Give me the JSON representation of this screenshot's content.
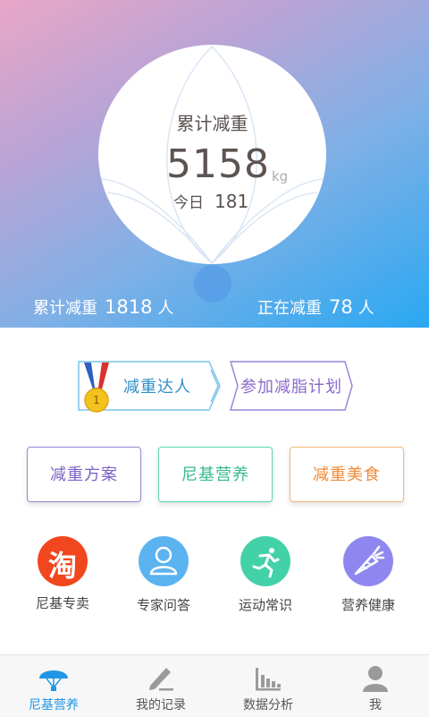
{
  "hero": {
    "title": "累计减重",
    "value": "5158",
    "unit": "kg",
    "today_label": "今日",
    "today_value": "181",
    "stats": {
      "left_label": "累计减重",
      "left_value": "1818",
      "left_unit": "人",
      "right_label": "正在减重",
      "right_value": "78",
      "right_unit": "人"
    }
  },
  "banners": {
    "expert": {
      "label": "减重达人",
      "badge": "1"
    },
    "join": {
      "label": "参加减脂计划"
    }
  },
  "plans": [
    {
      "label": "减重方案",
      "color": "#7a62c4"
    },
    {
      "label": "尼基营养",
      "color": "#36b890"
    },
    {
      "label": "减重美食",
      "color": "#f08a36"
    }
  ],
  "features": [
    {
      "label": "尼基专卖",
      "icon": "taobao-icon",
      "glyph": "淘",
      "color": "#f2461e"
    },
    {
      "label": "专家问答",
      "icon": "person-icon",
      "color": "#5bb3f0"
    },
    {
      "label": "运动常识",
      "icon": "running-icon",
      "color": "#43d1a8"
    },
    {
      "label": "营养健康",
      "icon": "carrot-icon",
      "color": "#8f87ef"
    }
  ],
  "tabs": [
    {
      "label": "尼基营养",
      "icon": "parachute-icon",
      "active": true
    },
    {
      "label": "我的记录",
      "icon": "pencil-icon"
    },
    {
      "label": "数据分析",
      "icon": "bar-chart-icon"
    },
    {
      "label": "我",
      "icon": "user-icon"
    }
  ],
  "colors": {
    "accent": "#2196e6"
  }
}
